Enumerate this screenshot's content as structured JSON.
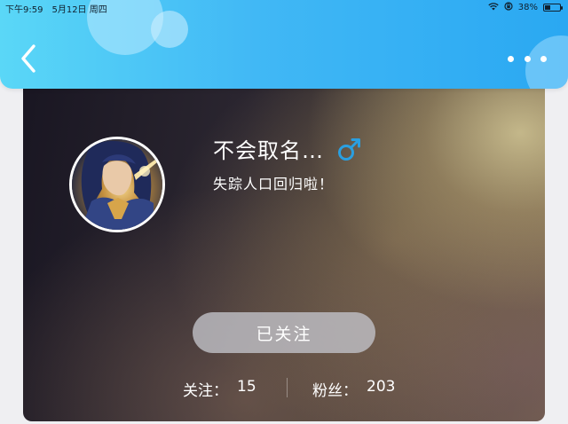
{
  "status_bar": {
    "time": "下午9:59",
    "date": "5月12日 周四",
    "battery": "38%",
    "battery_level": 0.38,
    "icons": [
      "wifi-icon",
      "rotation-lock-icon",
      "battery-icon"
    ]
  },
  "header": {
    "back_icon": "chevron-left-icon",
    "more_icon": "ellipsis-icon",
    "accent_color": "#41b8f5"
  },
  "profile": {
    "name": "不会取名…",
    "gender_icon": "male-symbol-icon",
    "gender_color": "#2a9fe0",
    "signature": "失踪人口回归啦！",
    "follow_button": "已关注",
    "following_label": "关注：",
    "following_count": "15",
    "fans_label": "粉丝：",
    "fans_count": "203"
  }
}
